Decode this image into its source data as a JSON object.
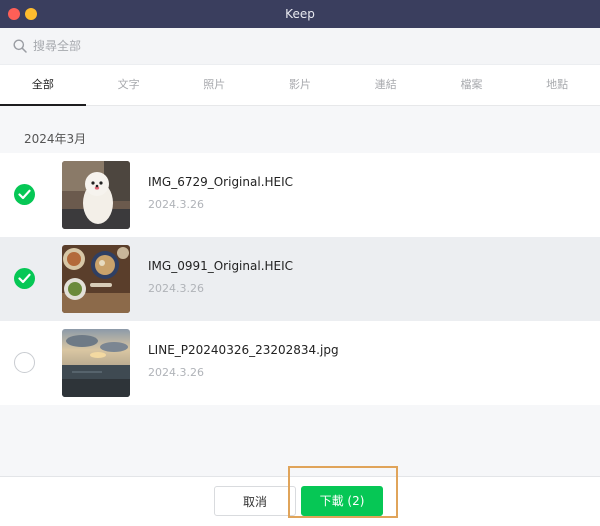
{
  "window": {
    "title": "Keep"
  },
  "search": {
    "placeholder": "搜尋全部"
  },
  "tabs": [
    {
      "label": "全部",
      "active": true
    },
    {
      "label": "文字",
      "active": false
    },
    {
      "label": "照片",
      "active": false
    },
    {
      "label": "影片",
      "active": false
    },
    {
      "label": "連結",
      "active": false
    },
    {
      "label": "檔案",
      "active": false
    },
    {
      "label": "地點",
      "active": false
    }
  ],
  "section": {
    "header": "2024年3月"
  },
  "items": [
    {
      "filename": "IMG_6729_Original.HEIC",
      "date": "2024.3.26",
      "checked": true
    },
    {
      "filename": "IMG_0991_Original.HEIC",
      "date": "2024.3.26",
      "checked": true
    },
    {
      "filename": "LINE_P20240326_23202834.jpg",
      "date": "2024.3.26",
      "checked": false
    }
  ],
  "footer": {
    "cancel_label": "取消",
    "download_label": "下載 (2)"
  },
  "colors": {
    "accent": "#06c755",
    "titlebar": "#3a3e5e",
    "highlight": "#e0a45a"
  }
}
